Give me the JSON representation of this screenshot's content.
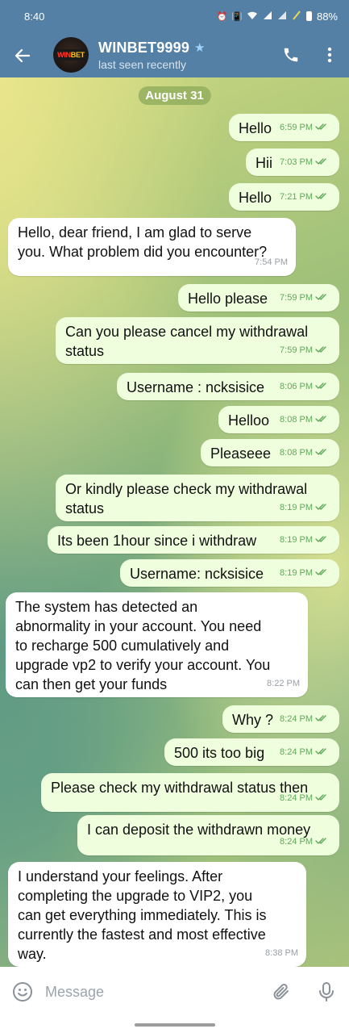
{
  "status_bar": {
    "time": "8:40",
    "battery": "88%"
  },
  "header": {
    "name": "WINBET9999",
    "status": "last seen recently",
    "avatar_text": [
      "WIN",
      "BET"
    ]
  },
  "date_separator": "August 31",
  "messages": [
    {
      "dir": "out",
      "lines": [
        "Hello"
      ],
      "time": "6:59 PM",
      "read": true
    },
    {
      "dir": "out",
      "lines": [
        "Hii"
      ],
      "time": "7:03 PM",
      "read": true
    },
    {
      "dir": "out",
      "lines": [
        "Hello"
      ],
      "time": "7:21 PM",
      "read": true
    },
    {
      "dir": "in",
      "lines": [
        "Hello, dear friend, I am glad to serve",
        "you. What problem did you encounter?"
      ],
      "time": "7:54 PM"
    },
    {
      "dir": "out",
      "lines": [
        "Hello please"
      ],
      "time": "7:59 PM",
      "read": true
    },
    {
      "dir": "out",
      "lines": [
        "Can you please cancel my withdrawal",
        "status"
      ],
      "time": "7:59 PM",
      "read": true
    },
    {
      "dir": "out",
      "lines": [
        "Username : ncksisice"
      ],
      "time": "8:06 PM",
      "read": true
    },
    {
      "dir": "out",
      "lines": [
        "Helloo"
      ],
      "time": "8:08 PM",
      "read": true
    },
    {
      "dir": "out",
      "lines": [
        "Pleaseee"
      ],
      "time": "8:08 PM",
      "read": true
    },
    {
      "dir": "out",
      "lines": [
        "Or kindly please check my withdrawal",
        "status"
      ],
      "time": "8:19 PM",
      "read": true
    },
    {
      "dir": "out",
      "lines": [
        "Its been 1hour since i withdraw"
      ],
      "time": "8:19 PM",
      "read": true
    },
    {
      "dir": "out",
      "lines": [
        "Username: ncksisice"
      ],
      "time": "8:19 PM",
      "read": true
    },
    {
      "dir": "in",
      "lines": [
        "The system has detected an",
        "abnormality in your account. You need",
        "to recharge 500 cumulatively and",
        "upgrade vp2 to verify your account. You",
        "can then get your funds"
      ],
      "time": "8:22 PM"
    },
    {
      "dir": "out",
      "lines": [
        "Why ?"
      ],
      "time": "8:24 PM",
      "read": true
    },
    {
      "dir": "out",
      "lines": [
        "500 its too big"
      ],
      "time": "8:24 PM",
      "read": true
    },
    {
      "dir": "out",
      "lines": [
        "Please check my withdrawal status then"
      ],
      "time": "8:24 PM",
      "read": true
    },
    {
      "dir": "out",
      "lines": [
        "I can deposit the withdrawn money"
      ],
      "time": "8:24 PM",
      "read": true
    },
    {
      "dir": "in",
      "lines": [
        "I understand your feelings. After",
        "completing the upgrade to VIP2, you",
        "can get everything immediately. This is",
        "currently the fastest and most effective",
        "way."
      ],
      "time": "8:38 PM"
    }
  ],
  "input": {
    "placeholder": "Message"
  },
  "colors": {
    "header": "#5580a6",
    "outgoing_bubble": "#effedd",
    "incoming_bubble": "#ffffff",
    "read_ticks": "#5ea958"
  }
}
